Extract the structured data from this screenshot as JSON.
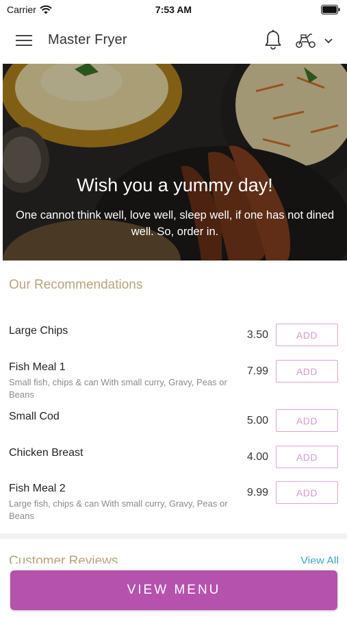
{
  "status_bar": {
    "carrier": "Carrier",
    "time": "7:53 AM",
    "icons": [
      "wifi-icon",
      "battery-icon"
    ]
  },
  "header": {
    "title": "Master Fryer",
    "icons": [
      "hamburger-menu-icon",
      "bell-icon",
      "scooter-icon",
      "chevron-down-icon"
    ]
  },
  "hero": {
    "title": "Wish you a yummy day!",
    "subtitle": "One cannot think well, love well, sleep well, if one has not dined well. So, order in."
  },
  "recommendations": {
    "title": "Our Recommendations",
    "items": [
      {
        "name": "Large Chips",
        "description": "",
        "price": "3.50",
        "action": "ADD"
      },
      {
        "name": "Fish Meal 1",
        "description": "Small fish, chips & can   With small curry, Gravy, Peas or Beans",
        "price": "7.99",
        "action": "ADD"
      },
      {
        "name": "Small Cod",
        "description": "",
        "price": "5.00",
        "action": "ADD"
      },
      {
        "name": "Chicken Breast",
        "description": "",
        "price": "4.00",
        "action": "ADD"
      },
      {
        "name": "Fish Meal 2",
        "description": "Large fish, chips & can   With small curry, Gravy, Peas or Beans",
        "price": "9.99",
        "action": "ADD"
      }
    ]
  },
  "reviews": {
    "title": "Customer Reviews",
    "view_all": "View All"
  },
  "footer": {
    "button_label": "VIEW MENU"
  },
  "colors": {
    "accent": "#b452ad",
    "add_border": "#d9a3d6",
    "section_title": "#b6a47a",
    "link": "#3ba7c4"
  }
}
